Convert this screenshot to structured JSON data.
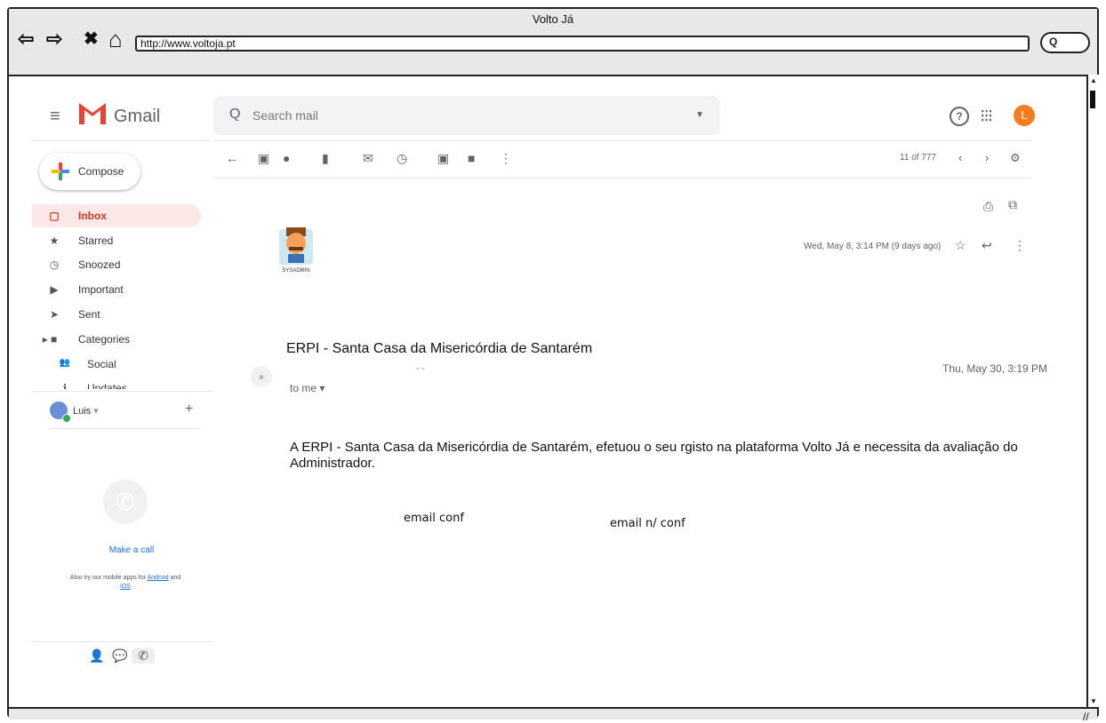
{
  "browser": {
    "title": "Volto Já",
    "url": "http://www.voltoja.pt",
    "nav": {
      "back": "⇦",
      "forward": "⇨",
      "stop": "✖",
      "home": "⌂"
    },
    "search_glyph": "Q"
  },
  "gmail": {
    "menu_icon": "≡",
    "app_name": "Gmail",
    "search": {
      "placeholder": "Search mail",
      "icon": "search-icon"
    },
    "help_glyph": "?",
    "apps_glyph": "⋮⋮⋮",
    "account_initial": "L",
    "account_color": "#f57c1f",
    "compose_label": "Compose",
    "sidebar": [
      {
        "label": "Inbox",
        "icon": "inbox-icon",
        "glyph": "▢",
        "active": true
      },
      {
        "label": "Starred",
        "icon": "star-icon",
        "glyph": "★",
        "active": false
      },
      {
        "label": "Snoozed",
        "icon": "clock-icon",
        "glyph": "◷",
        "active": false
      },
      {
        "label": "Important",
        "icon": "important-icon",
        "glyph": "▶",
        "active": false
      },
      {
        "label": "Sent",
        "icon": "send-icon",
        "glyph": "➤",
        "active": false
      },
      {
        "label": "Categories",
        "icon": "label-icon",
        "glyph": "▸ ■",
        "active": false
      },
      {
        "label": "Social",
        "icon": "people-icon",
        "glyph": "👥",
        "active": false
      },
      {
        "label": "Updates",
        "icon": "info-icon",
        "glyph": "ℹ",
        "active": false
      }
    ],
    "user": {
      "name": "Luis",
      "dropdown": "▾",
      "add": "+"
    },
    "hangouts": {
      "make_call": "Make a call",
      "also_text_1": "Also try our mobile apps for",
      "android": "Android",
      "and": "and",
      "ios": "iOS"
    },
    "toolbar": {
      "count": "11 of 777",
      "prev": "‹",
      "next": "›",
      "settings_glyph": "⚙"
    },
    "message_1": {
      "date": "Wed, May 8, 3:14 PM (9 days ago)",
      "avatar_label": "SYSADMIN"
    },
    "message_2": {
      "subject": "ERPI - Santa Casa da Misericórdia de Santarém",
      "sender_dashes": "- -",
      "to": "to me",
      "date": "Thu, May 30, 3:19 PM",
      "body": "A ERPI - Santa Casa da Misericórdia de Santarém, efetuou o seu rgisto na plataforma Volto Já e necessita da avaliação do Administrador.",
      "link_confirm": "email conf",
      "link_not_confirm": "email n/ conf"
    }
  }
}
